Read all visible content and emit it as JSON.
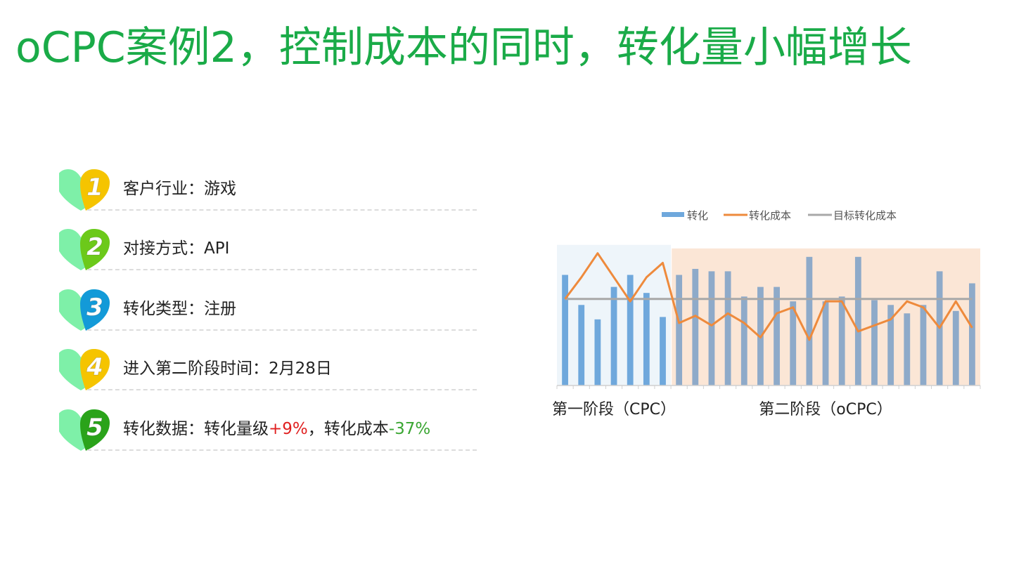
{
  "title": "oCPC案例2，控制成本的同时，转化量小幅增长",
  "items": [
    {
      "num": "1",
      "label": "客户行业：",
      "value": "游戏",
      "color": "#f5c400"
    },
    {
      "num": "2",
      "label": "对接方式：",
      "value": "API",
      "color": "#6cc91a"
    },
    {
      "num": "3",
      "label": "转化类型：",
      "value": "注册",
      "color": "#139ad8"
    },
    {
      "num": "4",
      "label": "进入第二阶段时间：",
      "value": "2月28日",
      "color": "#f5c400"
    },
    {
      "num": "5",
      "label": "转化数据：",
      "part1": "转化量级",
      "pos": "+9%",
      "sep": "，",
      "part2": "转化成本",
      "neg": "-37%",
      "color": "#2aa31a"
    }
  ],
  "colors": {
    "title": "#1aab48",
    "heart_back": "#7ef0a8"
  },
  "chart_data": {
    "type": "bar",
    "legend": {
      "placement": "top-center",
      "entries": [
        "转化",
        "转化成本",
        "目标转化成本"
      ]
    },
    "series": [
      {
        "name": "转化",
        "type": "bar",
        "values": [
          92,
          67,
          55,
          82,
          92,
          77,
          57,
          92,
          97,
          95,
          95,
          74,
          82,
          82,
          70,
          107,
          70,
          74,
          107,
          71,
          67,
          60,
          67,
          95,
          62,
          85
        ]
      },
      {
        "name": "转化成本",
        "type": "line",
        "values": [
          72,
          90,
          110,
          90,
          70,
          90,
          102,
          52,
          58,
          50,
          60,
          52,
          40,
          60,
          65,
          38,
          70,
          70,
          45,
          50,
          55,
          70,
          65,
          48,
          70,
          48
        ]
      },
      {
        "name": "目标转化成本",
        "type": "line",
        "values": [
          72,
          72,
          72,
          72,
          72,
          72,
          72,
          72,
          72,
          72,
          72,
          72,
          72,
          72,
          72,
          72,
          72,
          72,
          72,
          72,
          72,
          72,
          72,
          72,
          72,
          72
        ]
      }
    ],
    "ylim": [
      0,
      125
    ],
    "phases": [
      {
        "label": "第一阶段（CPC）",
        "start": 0,
        "end": 7,
        "color": "#eef5fa"
      },
      {
        "label": "第二阶段（oCPC）",
        "start": 7,
        "end": 25,
        "color": "#fbe6d6"
      }
    ],
    "colors": {
      "bar_phase1": "#6fa8dc",
      "bar_phase2": "#8eaac9",
      "cost": "#ee8a3c",
      "target": "#a8a8a8"
    },
    "grid": false
  }
}
